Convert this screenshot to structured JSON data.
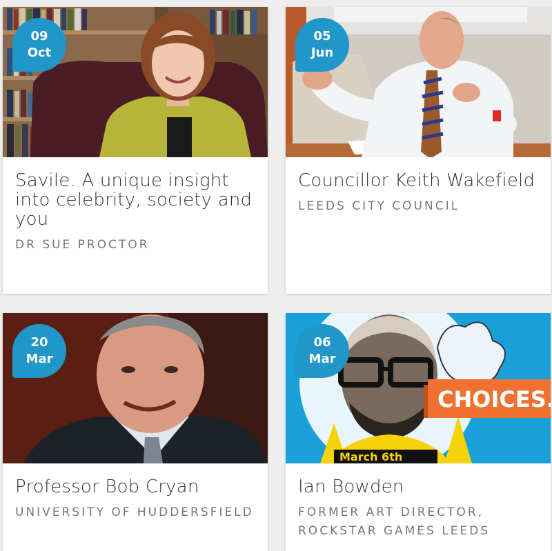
{
  "events": [
    {
      "day": "09",
      "month": "Oct",
      "title": "Savile. A unique insight into celebrity, society and you",
      "speaker": "DR SUE PROCTOR",
      "photo": "woman-in-green-jacket-bookshelf"
    },
    {
      "day": "05",
      "month": "Jun",
      "title": "Councillor Keith Wakefield",
      "speaker": "LEEDS CITY COUNCIL",
      "photo": "man-gesturing-at-table"
    },
    {
      "day": "20",
      "month": "Mar",
      "title": "Professor Bob Cryan",
      "speaker": "UNIVERSITY OF HUDDERSFIELD",
      "photo": "smiling-man-in-suit"
    },
    {
      "day": "06",
      "month": "Mar",
      "title": "Ian Bowden",
      "speaker": "FORMER ART DIRECTOR, ROCKSTAR GAMES LEEDS",
      "photo": "comic-illustration-choices",
      "poster_text": "CHOICES.",
      "poster_subtext": "March 6th"
    }
  ],
  "colors": {
    "badge": "#2196c9",
    "background": "#eeeeee"
  }
}
